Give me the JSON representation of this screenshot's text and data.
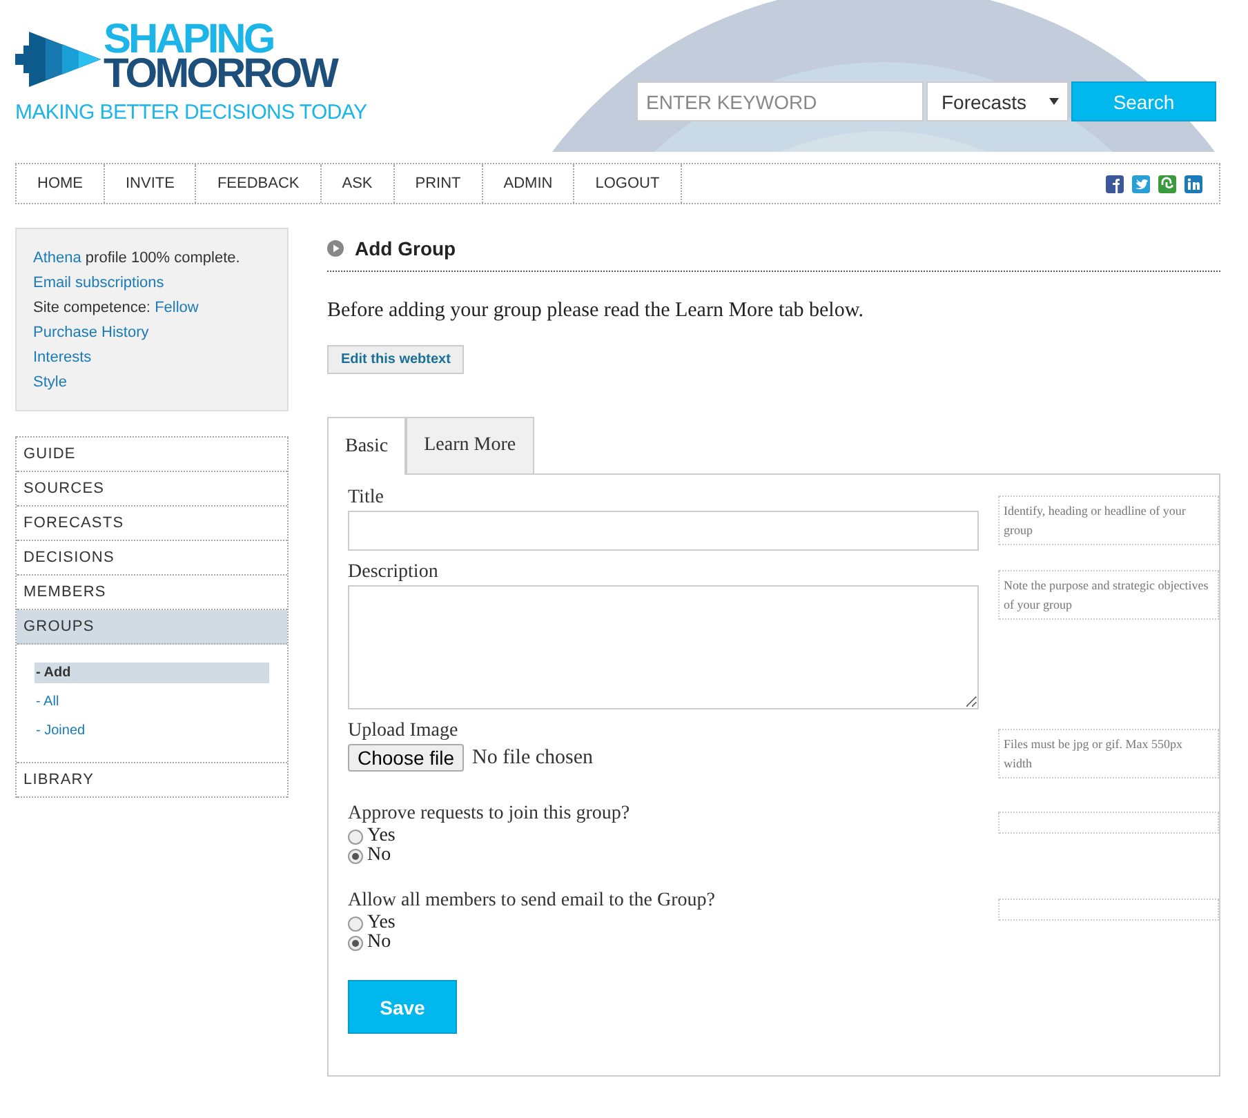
{
  "logo": {
    "line1": "SHAPING",
    "line2": "TOMORROW",
    "tagline": "MAKING BETTER DECISIONS TODAY"
  },
  "search": {
    "placeholder": "ENTER KEYWORD",
    "scope": "Forecasts",
    "button": "Search"
  },
  "nav": [
    "HOME",
    "INVITE",
    "FEEDBACK",
    "ASK",
    "PRINT",
    "ADMIN",
    "LOGOUT"
  ],
  "profile": [
    {
      "parts": [
        {
          "text": "Athena",
          "link": true
        },
        {
          "text": " profile 100% complete.",
          "link": false
        }
      ]
    },
    {
      "parts": [
        {
          "text": "Email subscriptions",
          "link": true
        }
      ]
    },
    {
      "parts": [
        {
          "text": "Site competence: ",
          "link": false
        },
        {
          "text": "Fellow",
          "link": true
        }
      ]
    },
    {
      "parts": [
        {
          "text": "Purchase History",
          "link": true
        }
      ]
    },
    {
      "parts": [
        {
          "text": "Interests",
          "link": true
        }
      ]
    },
    {
      "parts": [
        {
          "text": "Style",
          "link": true
        }
      ]
    }
  ],
  "menu": [
    {
      "label": "GUIDE",
      "selected": false
    },
    {
      "label": "SOURCES",
      "selected": false
    },
    {
      "label": "FORECASTS",
      "selected": false
    },
    {
      "label": "DECISIONS",
      "selected": false
    },
    {
      "label": "MEMBERS",
      "selected": false
    },
    {
      "label": "GROUPS",
      "selected": true,
      "children": [
        {
          "label": "- Add",
          "selected": true
        },
        {
          "label": "- All",
          "selected": false
        },
        {
          "label": "- Joined",
          "selected": false
        }
      ]
    },
    {
      "label": "LIBRARY",
      "selected": false
    }
  ],
  "page_title": "Add Group",
  "intro": "Before adding your group please read the Learn More tab below.",
  "edit_button": "Edit this webtext",
  "tabs": [
    {
      "label": "Basic",
      "selected": true
    },
    {
      "label": "Learn More",
      "selected": false
    }
  ],
  "fields": [
    {
      "kind": "text",
      "label": "Title",
      "help": "Identify, heading or headline of your group"
    },
    {
      "kind": "textarea",
      "label": "Description",
      "help": "Note the purpose and strategic objectives of your group"
    },
    {
      "kind": "file",
      "label": "Upload Image",
      "button": "Choose file",
      "status": "No file chosen",
      "help": "Files must be jpg or gif. Max 550px width"
    },
    {
      "kind": "radio",
      "label": "Approve requests to join this group?",
      "options": [
        {
          "label": "Yes",
          "selected": false
        },
        {
          "label": "No",
          "selected": true
        }
      ]
    },
    {
      "kind": "radio",
      "label": "Allow all members to send email to the Group?",
      "options": [
        {
          "label": "Yes",
          "selected": false
        },
        {
          "label": "No",
          "selected": true
        }
      ]
    }
  ],
  "save_button": "Save"
}
